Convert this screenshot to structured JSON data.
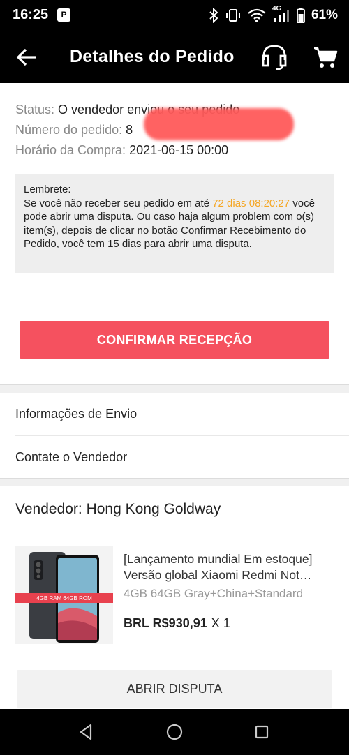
{
  "status_bar": {
    "time": "16:25",
    "p_icon": "P",
    "network": "4G",
    "battery": "61%",
    "icons": [
      "bluetooth-icon",
      "vibrate-icon",
      "wifi-icon",
      "signal-icon",
      "battery-icon"
    ]
  },
  "header": {
    "title": "Detalhes do Pedido",
    "icons": [
      "back-arrow-icon",
      "headset-support-icon",
      "cart-icon"
    ]
  },
  "order": {
    "status_label": "Status:",
    "status_value": "O vendedor enviou o seu pedido",
    "number_label": "Número do pedido:",
    "number_value": "8",
    "purchase_label": "Horário da Compra:",
    "purchase_value": "2021-06-15 00:00"
  },
  "reminder": {
    "title": "Lembrete:",
    "text_before": "Se você não receber seu pedido em até ",
    "countdown": "72 dias 08:20:27",
    "text_after": " você pode abrir uma disputa. Ou caso haja algum problem com o(s) item(s), depois de clicar no botão Confirmar Recebimento do Pedido, você tem 15 dias para abrir uma disputa."
  },
  "confirm_button": "CONFIRMAR RECEPÇÃO",
  "menu": {
    "shipping_info": "Informações de Envio",
    "contact_seller": "Contate o Vendedor"
  },
  "seller": {
    "label": "Vendedor: Hong Kong Goldway"
  },
  "product": {
    "image_badge": "4GB RAM 64GB ROM",
    "title": "[Lançamento mundial Em estoque] Versão global Xiaomi Redmi Not…",
    "variant": "4GB 64GB Gray+China+Standard",
    "price": "BRL R$930,91",
    "quantity": "X 1"
  },
  "dispute_button": "ABRIR DISPUTA",
  "nav_bar": {
    "icons": [
      "back-triangle-icon",
      "home-circle-icon",
      "recents-square-icon"
    ]
  },
  "colors": {
    "accent": "#f5515f",
    "countdown": "#f5a623",
    "header_bg": "#000000"
  }
}
